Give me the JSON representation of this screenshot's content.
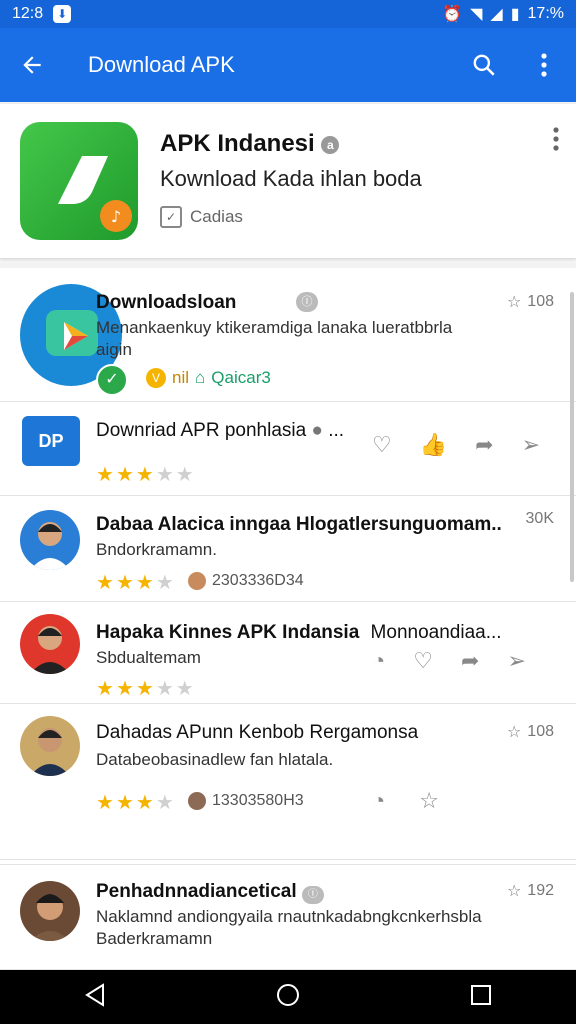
{
  "status": {
    "time": "12:8",
    "battery": "17:%"
  },
  "appbar": {
    "title": "Download APK"
  },
  "hero": {
    "title": "APK Indanesi",
    "subtitle": "Kownload Kada ihlan boda",
    "category": "Cadias"
  },
  "rows": [
    {
      "title": "Downloadsloan",
      "subtitle": "Menankaenkuy ktikeramdiga lanaka lueratbbrla",
      "subtitle2": "aigin",
      "meta": "108",
      "tag1": "nil",
      "tag2": "Qaicar3"
    },
    {
      "title": "Downriad APR ponhlasia",
      "title_suffix": "...",
      "rating": 3
    },
    {
      "title": "Dabaa Alacica inngaa Hlogatlersunguomam..",
      "subtitle": "Bndorkramamn.",
      "meta": "30K",
      "rating": 3,
      "extra": "2303336D34"
    },
    {
      "title": "Hapaka Kinnes APK Indansia",
      "title_tail": "Monnoandiaa...",
      "subtitle": "Sbdualtemam",
      "rating": 3
    },
    {
      "title": "Dahadas APunn Kenbob Rergamonsa",
      "subtitle": "Databeobasinadlew fan hlatala.",
      "meta": "108",
      "rating": 3,
      "extra": "13303580H3"
    },
    {
      "title": "Penhadnnadiancetical",
      "subtitle": "Naklamnd andiongyaila rnautnkadabngkcnkerhsbla",
      "subtitle2": "Baderkramamn",
      "meta": "192"
    }
  ],
  "colors": {
    "primary": "#1a6fe6",
    "star": "#f5b400"
  }
}
